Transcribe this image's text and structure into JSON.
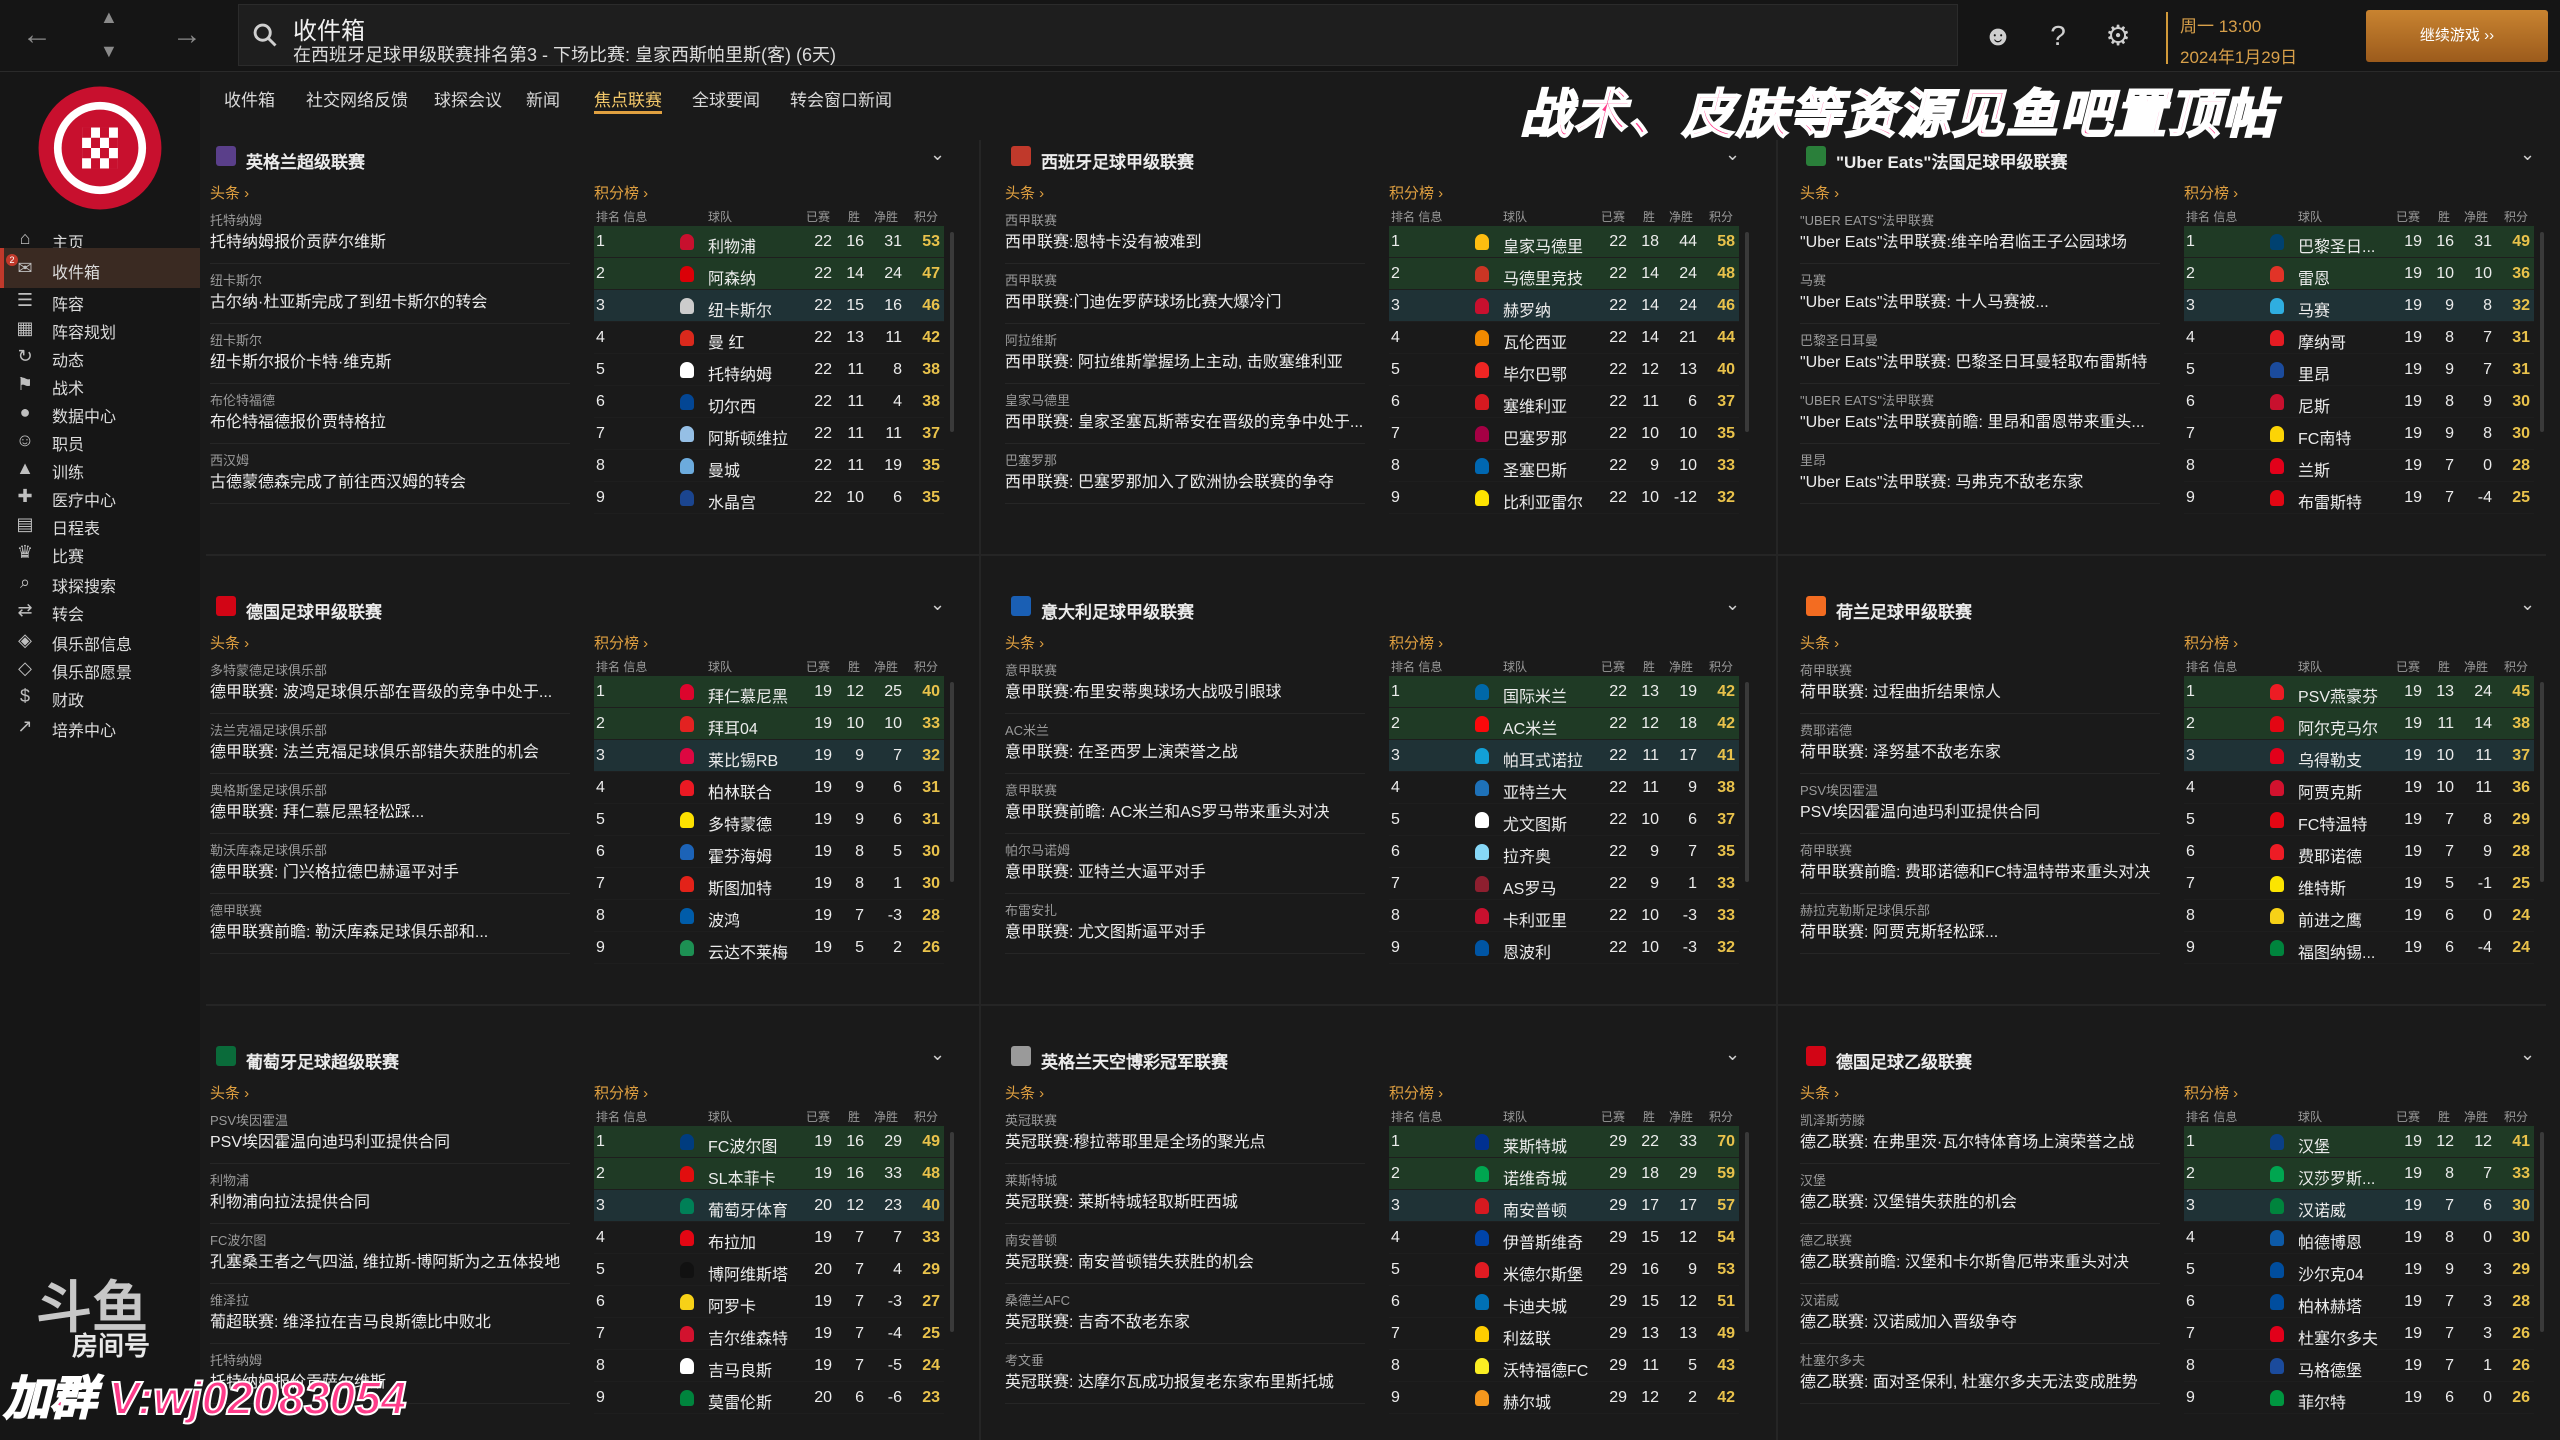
{
  "search": {
    "title": "收件箱",
    "subtitle": "在西班牙足球甲级联赛排名第3 - 下场比赛: 皇家西斯帕里斯(客) (6天)"
  },
  "date": {
    "day": "周一 13:00",
    "full": "2024年1月29日"
  },
  "continue_label": "继续游戏 ››",
  "sidebar": {
    "badge": "2",
    "items": [
      {
        "label": "主页",
        "icon": "home-icon"
      },
      {
        "label": "收件箱",
        "icon": "inbox-icon"
      },
      {
        "label": "阵容",
        "icon": "squad-icon"
      },
      {
        "label": "阵容规划",
        "icon": "planner-icon"
      },
      {
        "label": "动态",
        "icon": "dynamics-icon"
      },
      {
        "label": "战术",
        "icon": "tactics-icon"
      },
      {
        "label": "数据中心",
        "icon": "data-icon"
      },
      {
        "label": "职员",
        "icon": "staff-icon"
      },
      {
        "label": "训练",
        "icon": "training-icon"
      },
      {
        "label": "医疗中心",
        "icon": "medical-icon"
      },
      {
        "label": "日程表",
        "icon": "calendar-icon"
      },
      {
        "label": "比赛",
        "icon": "trophy-icon"
      },
      {
        "label": "球探搜索",
        "icon": "scouting-icon"
      },
      {
        "label": "转会",
        "icon": "transfer-icon"
      },
      {
        "label": "俱乐部信息",
        "icon": "club-info-icon"
      },
      {
        "label": "俱乐部愿景",
        "icon": "vision-icon"
      },
      {
        "label": "财政",
        "icon": "finance-icon"
      },
      {
        "label": "培养中心",
        "icon": "development-icon"
      }
    ]
  },
  "tabs": [
    "收件箱",
    "社交网络反馈",
    "球探会议",
    "新闻",
    "焦点联赛",
    "全球要闻",
    "转会窗口新闻"
  ],
  "banner": "战术、皮肤等资源见鱼吧置顶帖",
  "labels": {
    "news_head": "头条 ›",
    "table_head": "积分榜 ›",
    "col_pos": "排名 信息",
    "col_team": "球队",
    "col_pl": "已赛",
    "col_w": "胜",
    "col_gd": "净胜",
    "col_pts": "积分"
  },
  "colors": {
    "accent": "#e0a040",
    "highlight": "#1f3a25",
    "points": "#e9c24b"
  },
  "panels": [
    {
      "title": "英格兰超级联赛",
      "logo_color": "#5a3f8a",
      "news": [
        {
          "src": "托特纳姆",
          "text": "托特纳姆报价贡萨尔维斯"
        },
        {
          "src": "纽卡斯尔",
          "text": "古尔纳·杜亚斯完成了到纽卡斯尔的转会"
        },
        {
          "src": "纽卡斯尔",
          "text": "纽卡斯尔报价卡特·维克斯"
        },
        {
          "src": "布伦特福德",
          "text": "布伦特福德报价贾特格拉"
        },
        {
          "src": "西汉姆",
          "text": "古德蒙德森完成了前往西汉姆的转会"
        }
      ],
      "rows": [
        [
          "1",
          "利物浦",
          "22",
          "16",
          "31",
          "53",
          "#c8102e"
        ],
        [
          "2",
          "阿森纳",
          "22",
          "14",
          "24",
          "47",
          "#db0007"
        ],
        [
          "3",
          "纽卡斯尔",
          "22",
          "15",
          "16",
          "46",
          "#cccccc"
        ],
        [
          "4",
          "曼 红",
          "22",
          "13",
          "11",
          "42",
          "#da291c"
        ],
        [
          "5",
          "托特纳姆",
          "22",
          "11",
          "8",
          "38",
          "#ffffff"
        ],
        [
          "6",
          "切尔西",
          "22",
          "11",
          "4",
          "38",
          "#034694"
        ],
        [
          "7",
          "阿斯顿维拉",
          "22",
          "11",
          "11",
          "37",
          "#95bfe5"
        ],
        [
          "8",
          "曼城",
          "22",
          "11",
          "19",
          "35",
          "#6cabdd"
        ],
        [
          "9",
          "水晶宫",
          "22",
          "10",
          "6",
          "35",
          "#1b458f"
        ]
      ]
    },
    {
      "title": "西班牙足球甲级联赛",
      "logo_color": "#c0392b",
      "news": [
        {
          "src": "西甲联赛",
          "text": "西甲联赛:恩特卡没有被难到"
        },
        {
          "src": "西甲联赛",
          "text": "西甲联赛:门迪佐罗萨球场比赛大爆冷门"
        },
        {
          "src": "阿拉维斯",
          "text": "西甲联赛: 阿拉维斯掌握场上主动, 击败塞维利亚"
        },
        {
          "src": "皇家马德里",
          "text": "西甲联赛: 皇家圣塞瓦斯蒂安在晋级的竞争中处于..."
        },
        {
          "src": "巴塞罗那",
          "text": "西甲联赛: 巴塞罗那加入了欧洲协会联赛的争夺"
        }
      ],
      "rows": [
        [
          "1",
          "皇家马德里",
          "22",
          "18",
          "44",
          "58",
          "#febe10"
        ],
        [
          "2",
          "马德里竞技",
          "22",
          "14",
          "24",
          "48",
          "#cb3524"
        ],
        [
          "3",
          "赫罗纳",
          "22",
          "14",
          "24",
          "46",
          "#c8102e"
        ],
        [
          "4",
          "瓦伦西亚",
          "22",
          "14",
          "21",
          "44",
          "#f18a00"
        ],
        [
          "5",
          "毕尔巴鄂",
          "22",
          "12",
          "13",
          "40",
          "#ee2523"
        ],
        [
          "6",
          "塞维利亚",
          "22",
          "11",
          "6",
          "37",
          "#d71920"
        ],
        [
          "7",
          "巴塞罗那",
          "22",
          "10",
          "10",
          "35",
          "#a50044"
        ],
        [
          "8",
          "圣塞巴斯",
          "22",
          "9",
          "10",
          "33",
          "#0067b1"
        ],
        [
          "9",
          "比利亚雷尔",
          "22",
          "10",
          "-12",
          "32",
          "#fde300"
        ]
      ]
    },
    {
      "title": "\"Uber Eats\"法国足球甲级联赛",
      "logo_color": "#2a7f3a",
      "news": [
        {
          "src": "\"UBER EATS\"法甲联赛",
          "text": "\"Uber Eats\"法甲联赛:维辛哈君临王子公园球场"
        },
        {
          "src": "马赛",
          "text": "\"Uber Eats\"法甲联赛: 十人马赛被..."
        },
        {
          "src": "巴黎圣日耳曼",
          "text": "\"Uber Eats\"法甲联赛: 巴黎圣日耳曼轻取布雷斯特"
        },
        {
          "src": "\"UBER EATS\"法甲联赛",
          "text": "\"Uber Eats\"法甲联赛前瞻: 里昂和雷恩带来重头..."
        },
        {
          "src": "里昂",
          "text": "\"Uber Eats\"法甲联赛: 马弗克不敌老东家"
        }
      ],
      "rows": [
        [
          "1",
          "巴黎圣日...",
          "19",
          "16",
          "31",
          "49",
          "#004170"
        ],
        [
          "2",
          "雷恩",
          "19",
          "10",
          "10",
          "36",
          "#e13327"
        ],
        [
          "3",
          "马赛",
          "19",
          "9",
          "8",
          "32",
          "#2faee0"
        ],
        [
          "4",
          "摩纳哥",
          "19",
          "8",
          "7",
          "31",
          "#e51b22"
        ],
        [
          "5",
          "里昂",
          "19",
          "9",
          "7",
          "31",
          "#1b4b9c"
        ],
        [
          "6",
          "尼斯",
          "19",
          "8",
          "9",
          "30",
          "#c8102e"
        ],
        [
          "7",
          "FC南特",
          "19",
          "9",
          "8",
          "30",
          "#fcd405"
        ],
        [
          "8",
          "兰斯",
          "19",
          "7",
          "0",
          "28",
          "#e2001a"
        ],
        [
          "9",
          "布雷斯特",
          "19",
          "7",
          "-4",
          "25",
          "#e30613"
        ]
      ]
    },
    {
      "title": "德国足球甲级联赛",
      "logo_color": "#d20515",
      "news": [
        {
          "src": "多特蒙德足球俱乐部",
          "text": "德甲联赛: 波鸿足球俱乐部在晋级的竞争中处于..."
        },
        {
          "src": "法兰克福足球俱乐部",
          "text": "德甲联赛: 法兰克福足球俱乐部错失获胜的机会"
        },
        {
          "src": "奥格斯堡足球俱乐部",
          "text": "德甲联赛: 拜仁慕尼黑轻松踩..."
        },
        {
          "src": "勒沃库森足球俱乐部",
          "text": "德甲联赛: 门兴格拉德巴赫逼平对手"
        },
        {
          "src": "德甲联赛",
          "text": "德甲联赛前瞻: 勒沃库森足球俱乐部和..."
        }
      ],
      "rows": [
        [
          "1",
          "拜仁慕尼黑",
          "19",
          "12",
          "25",
          "40",
          "#dc052d"
        ],
        [
          "2",
          "拜耳04",
          "19",
          "10",
          "10",
          "33",
          "#e32221"
        ],
        [
          "3",
          "莱比锡RB",
          "19",
          "9",
          "7",
          "32",
          "#dd0741"
        ],
        [
          "4",
          "柏林联合",
          "19",
          "9",
          "6",
          "31",
          "#eb1923"
        ],
        [
          "5",
          "多特蒙德",
          "19",
          "9",
          "6",
          "31",
          "#fde100"
        ],
        [
          "6",
          "霍芬海姆",
          "19",
          "8",
          "5",
          "30",
          "#1c63b7"
        ],
        [
          "7",
          "斯图加特",
          "19",
          "8",
          "1",
          "30",
          "#e32219"
        ],
        [
          "8",
          "波鸿",
          "19",
          "7",
          "-3",
          "28",
          "#005ca9"
        ],
        [
          "9",
          "云达不莱梅",
          "19",
          "5",
          "2",
          "26",
          "#1d9053"
        ]
      ]
    },
    {
      "title": "意大利足球甲级联赛",
      "logo_color": "#1a5fb4",
      "news": [
        {
          "src": "意甲联赛",
          "text": "意甲联赛:布里安蒂奥球场大战吸引眼球"
        },
        {
          "src": "AC米兰",
          "text": "意甲联赛: 在圣西罗上演荣誉之战"
        },
        {
          "src": "意甲联赛",
          "text": "意甲联赛前瞻: AC米兰和AS罗马带来重头对决"
        },
        {
          "src": "帕尔马诺姆",
          "text": "意甲联赛: 亚特兰大逼平对手"
        },
        {
          "src": "布雷安扎",
          "text": "意甲联赛: 尤文图斯逼平对手"
        }
      ],
      "rows": [
        [
          "1",
          "国际米兰",
          "22",
          "13",
          "19",
          "42",
          "#0068a8"
        ],
        [
          "2",
          "AC米兰",
          "22",
          "12",
          "18",
          "42",
          "#fb090b"
        ],
        [
          "3",
          "帕耳式诺拉",
          "22",
          "11",
          "17",
          "41",
          "#12a0d7"
        ],
        [
          "4",
          "亚特兰大",
          "22",
          "11",
          "9",
          "38",
          "#1e71b8"
        ],
        [
          "5",
          "尤文图斯",
          "22",
          "10",
          "6",
          "37",
          "#ffffff"
        ],
        [
          "6",
          "拉齐奥",
          "22",
          "9",
          "7",
          "35",
          "#87d8f7"
        ],
        [
          "7",
          "AS罗马",
          "22",
          "9",
          "1",
          "33",
          "#8e1f2f"
        ],
        [
          "8",
          "卡利亚里",
          "22",
          "10",
          "-3",
          "33",
          "#c8102e"
        ],
        [
          "9",
          "恩波利",
          "22",
          "10",
          "-3",
          "32",
          "#0055a4"
        ]
      ]
    },
    {
      "title": "荷兰足球甲级联赛",
      "logo_color": "#f36c21",
      "news": [
        {
          "src": "荷甲联赛",
          "text": "荷甲联赛: 过程曲折结果惊人"
        },
        {
          "src": "费耶诺德",
          "text": "荷甲联赛: 泽努基不敌老东家"
        },
        {
          "src": "PSV埃因霍温",
          "text": "PSV埃因霍温向迪玛利亚提供合同"
        },
        {
          "src": "荷甲联赛",
          "text": "荷甲联赛前瞻: 费耶诺德和FC特温特带来重头对决"
        },
        {
          "src": "赫拉克勒斯足球俱乐部",
          "text": "荷甲联赛: 阿贾克斯轻松踩..."
        }
      ],
      "rows": [
        [
          "1",
          "PSV燕豪芬",
          "19",
          "13",
          "24",
          "45",
          "#ed1c24"
        ],
        [
          "2",
          "阿尔克马尔",
          "19",
          "11",
          "14",
          "38",
          "#e30613"
        ],
        [
          "3",
          "乌得勒支",
          "19",
          "10",
          "11",
          "37",
          "#e2001a"
        ],
        [
          "4",
          "阿贾克斯",
          "19",
          "10",
          "11",
          "36",
          "#d2122e"
        ],
        [
          "5",
          "FC特温特",
          "19",
          "7",
          "8",
          "29",
          "#e30613"
        ],
        [
          "6",
          "费耶诺德",
          "19",
          "7",
          "9",
          "28",
          "#ee1c25"
        ],
        [
          "7",
          "维特斯",
          "19",
          "5",
          "-1",
          "25",
          "#fce500"
        ],
        [
          "8",
          "前进之鹰",
          "19",
          "6",
          "0",
          "24",
          "#f7d117"
        ],
        [
          "9",
          "福图纳锡...",
          "19",
          "6",
          "-4",
          "24",
          "#00843d"
        ]
      ]
    },
    {
      "title": "葡萄牙足球超级联赛",
      "logo_color": "#0a6b3a",
      "news": [
        {
          "src": "PSV埃因霍温",
          "text": "PSV埃因霍温向迪玛利亚提供合同"
        },
        {
          "src": "利物浦",
          "text": "利物浦向拉法提供合同"
        },
        {
          "src": "FC波尔图",
          "text": "孔塞桑王者之气四溢, 维拉斯-博阿斯为之五体投地"
        },
        {
          "src": "维泽拉",
          "text": "葡超联赛: 维泽拉在吉马良斯德比中败北"
        },
        {
          "src": "托特纳姆",
          "text": "托特纳姆报价贡萨尔维斯"
        }
      ],
      "rows": [
        [
          "1",
          "FC波尔图",
          "19",
          "16",
          "29",
          "49",
          "#003c7f"
        ],
        [
          "2",
          "SL本菲卡",
          "19",
          "16",
          "33",
          "48",
          "#e20e0e"
        ],
        [
          "3",
          "葡萄牙体育",
          "20",
          "12",
          "23",
          "40",
          "#008057"
        ],
        [
          "4",
          "布拉加",
          "19",
          "7",
          "7",
          "33",
          "#e30613"
        ],
        [
          "5",
          "博阿维斯塔",
          "20",
          "7",
          "4",
          "29",
          "#111111"
        ],
        [
          "6",
          "阿罗卡",
          "19",
          "7",
          "-3",
          "27",
          "#f7d117"
        ],
        [
          "7",
          "吉尔维森特",
          "19",
          "7",
          "-4",
          "25",
          "#d2122e"
        ],
        [
          "8",
          "吉马良斯",
          "19",
          "7",
          "-5",
          "24",
          "#ffffff"
        ],
        [
          "9",
          "莫雷伦斯",
          "20",
          "6",
          "-6",
          "23",
          "#00843d"
        ]
      ]
    },
    {
      "title": "英格兰天空博彩冠军联赛",
      "logo_color": "#9a9a9a",
      "news": [
        {
          "src": "英冠联赛",
          "text": "英冠联赛:穆拉蒂耶里是全场的聚光点"
        },
        {
          "src": "莱斯特城",
          "text": "英冠联赛: 莱斯特城轻取斯旺西城"
        },
        {
          "src": "南安普顿",
          "text": "英冠联赛: 南安普顿错失获胜的机会"
        },
        {
          "src": "桑德兰AFC",
          "text": "英冠联赛: 吉奇不敌老东家"
        },
        {
          "src": "考文垂",
          "text": "英冠联赛: 达摩尔瓦成功报复老东家布里斯托城"
        }
      ],
      "rows": [
        [
          "1",
          "莱斯特城",
          "29",
          "22",
          "33",
          "70",
          "#003090"
        ],
        [
          "2",
          "诺维奇城",
          "29",
          "18",
          "29",
          "59",
          "#00a650"
        ],
        [
          "3",
          "南安普顿",
          "29",
          "17",
          "17",
          "57",
          "#d71920"
        ],
        [
          "4",
          "伊普斯维奇",
          "29",
          "15",
          "12",
          "54",
          "#0044a9"
        ],
        [
          "5",
          "米德尔斯堡",
          "29",
          "16",
          "9",
          "53",
          "#e11b22"
        ],
        [
          "6",
          "卡迪夫城",
          "29",
          "15",
          "12",
          "51",
          "#0070b5"
        ],
        [
          "7",
          "利兹联",
          "29",
          "13",
          "13",
          "49",
          "#ffcd00"
        ],
        [
          "8",
          "沃特福德FC",
          "29",
          "11",
          "5",
          "43",
          "#fbee23"
        ],
        [
          "9",
          "赫尔城",
          "29",
          "12",
          "2",
          "42",
          "#f5971d"
        ]
      ]
    },
    {
      "title": "德国足球乙级联赛",
      "logo_color": "#d20515",
      "news": [
        {
          "src": "凯泽斯劳滕",
          "text": "德乙联赛: 在弗里茨·瓦尔特体育场上演荣誉之战"
        },
        {
          "src": "汉堡",
          "text": "德乙联赛: 汉堡错失获胜的机会"
        },
        {
          "src": "德乙联赛",
          "text": "德乙联赛前瞻: 汉堡和卡尔斯鲁厄带来重头对决"
        },
        {
          "src": "汉诺威",
          "text": "德乙联赛: 汉诺威加入晋级争夺"
        },
        {
          "src": "杜塞尔多夫",
          "text": "德乙联赛: 面对圣保利, 杜塞尔多夫无法变成胜势"
        }
      ],
      "rows": [
        [
          "1",
          "汉堡",
          "19",
          "12",
          "12",
          "41",
          "#0a3f86"
        ],
        [
          "2",
          "汉莎罗斯...",
          "19",
          "8",
          "7",
          "33",
          "#00a650"
        ],
        [
          "3",
          "汉诺威",
          "19",
          "7",
          "6",
          "30",
          "#00843d"
        ],
        [
          "4",
          "帕德博恩",
          "19",
          "8",
          "0",
          "30",
          "#0d5aa7"
        ],
        [
          "5",
          "沙尔克04",
          "19",
          "9",
          "3",
          "29",
          "#004d9d"
        ],
        [
          "6",
          "柏林赫塔",
          "19",
          "7",
          "3",
          "28",
          "#004d9e"
        ],
        [
          "7",
          "杜塞尔多夫",
          "19",
          "7",
          "3",
          "26",
          "#e2001a"
        ],
        [
          "8",
          "马格德堡",
          "19",
          "7",
          "1",
          "26",
          "#1b4b9c"
        ],
        [
          "9",
          "菲尔特",
          "19",
          "6",
          "0",
          "26",
          "#009640"
        ]
      ]
    }
  ],
  "watermark": {
    "room": "房间号",
    "contact": "加群 V:wj02083054"
  }
}
